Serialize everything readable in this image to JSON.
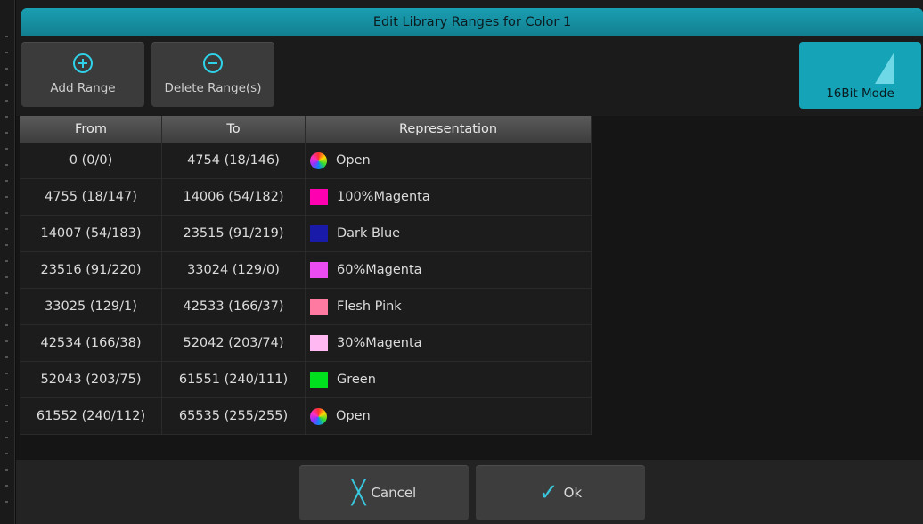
{
  "dialog": {
    "title": "Edit Library Ranges for Color 1"
  },
  "toolbar": {
    "add_range": "Add Range",
    "delete_ranges": "Delete Range(s)",
    "mode_16bit": "16Bit Mode"
  },
  "table": {
    "headers": [
      "From",
      "To",
      "Representation"
    ],
    "rows": [
      {
        "from": "0 (0/0)",
        "to": "4754 (18/146)",
        "rep": "Open",
        "swatch": "wheel"
      },
      {
        "from": "4755 (18/147)",
        "to": "14006 (54/182)",
        "rep": "100%Magenta",
        "swatch": "#ff00b0"
      },
      {
        "from": "14007 (54/183)",
        "to": "23515 (91/219)",
        "rep": "Dark Blue",
        "swatch": "#1a1aa8"
      },
      {
        "from": "23516 (91/220)",
        "to": "33024 (129/0)",
        "rep": "60%Magenta",
        "swatch": "#e94cf0"
      },
      {
        "from": "33025 (129/1)",
        "to": "42533 (166/37)",
        "rep": "Flesh Pink",
        "swatch": "#ff7aa0"
      },
      {
        "from": "42534 (166/38)",
        "to": "52042 (203/74)",
        "rep": "30%Magenta",
        "swatch": "#ffb8f2"
      },
      {
        "from": "52043 (203/75)",
        "to": "61551 (240/111)",
        "rep": "Green",
        "swatch": "#00e01e"
      },
      {
        "from": "61552 (240/112)",
        "to": "65535 (255/255)",
        "rep": "Open",
        "swatch": "wheel"
      }
    ]
  },
  "footer": {
    "cancel": "Cancel",
    "ok": "Ok"
  },
  "colors": {
    "accent": "#15a3b8",
    "icon": "#2fd2e8"
  }
}
